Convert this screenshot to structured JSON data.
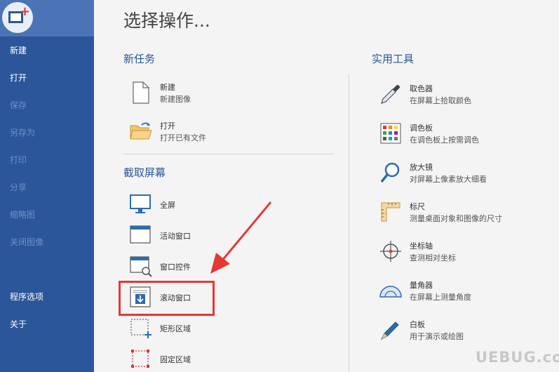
{
  "main": {
    "title": "选择操作..."
  },
  "sidebar": {
    "items": [
      {
        "label": "新建",
        "enabled": true
      },
      {
        "label": "打开",
        "enabled": true
      },
      {
        "label": "保存",
        "enabled": false
      },
      {
        "label": "另存为",
        "enabled": false
      },
      {
        "label": "打印",
        "enabled": false
      },
      {
        "label": "分享",
        "enabled": false
      },
      {
        "label": "缩略图",
        "enabled": false
      },
      {
        "label": "关闭图像",
        "enabled": false
      },
      {
        "label": "程序选项",
        "enabled": true
      },
      {
        "label": "关于",
        "enabled": true
      }
    ]
  },
  "sections": {
    "new_task": {
      "title": "新任务",
      "items": [
        {
          "title": "新建",
          "desc": "新建图像",
          "icon": "blank-document-icon"
        },
        {
          "title": "打开",
          "desc": "打开已有文件",
          "icon": "open-folder-icon"
        }
      ]
    },
    "capture": {
      "title": "截取屏幕",
      "items": [
        {
          "title": "全屏",
          "icon": "monitor-icon"
        },
        {
          "title": "活动窗口",
          "icon": "window-icon"
        },
        {
          "title": "窗口控件",
          "icon": "window-magnifier-icon"
        },
        {
          "title": "滚动窗口",
          "icon": "scroll-window-icon"
        },
        {
          "title": "矩形区域",
          "icon": "rectangle-region-icon"
        },
        {
          "title": "固定区域",
          "icon": "fixed-region-icon"
        }
      ]
    },
    "tools": {
      "title": "实用工具",
      "items": [
        {
          "title": "取色器",
          "desc": "在屏幕上拾取颜色",
          "icon": "eyedropper-icon"
        },
        {
          "title": "调色板",
          "desc": "在调色板上按需调色",
          "icon": "palette-icon"
        },
        {
          "title": "放大镜",
          "desc": "对屏幕上像素放大细看",
          "icon": "magnifier-icon"
        },
        {
          "title": "标尺",
          "desc": "测量桌面对象和图像的尺寸",
          "icon": "ruler-icon"
        },
        {
          "title": "坐标轴",
          "desc": "查测相对坐标",
          "icon": "crosshair-icon"
        },
        {
          "title": "量角器",
          "desc": "在屏幕上测量角度",
          "icon": "protractor-icon"
        },
        {
          "title": "白板",
          "desc": "用于演示或绘图",
          "icon": "pen-icon"
        }
      ]
    }
  },
  "watermark": {
    "text": "UEBUG.com"
  },
  "colors": {
    "sidebar": "#2b579a",
    "accent": "#2b579a",
    "highlight": "#e53935",
    "background": "#f4f4f4"
  }
}
